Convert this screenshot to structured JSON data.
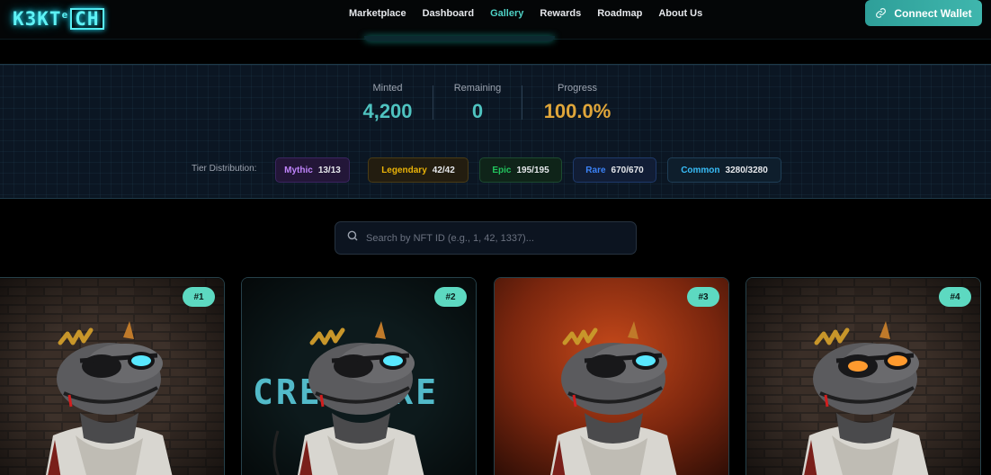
{
  "brand": {
    "logo_text": "K3KT",
    "logo_sup": "e",
    "logo_box": "CH"
  },
  "nav": {
    "items": [
      {
        "label": "Marketplace",
        "active": false
      },
      {
        "label": "Dashboard",
        "active": false
      },
      {
        "label": "Gallery",
        "active": true
      },
      {
        "label": "Rewards",
        "active": false
      },
      {
        "label": "Roadmap",
        "active": false
      },
      {
        "label": "About Us",
        "active": false
      }
    ],
    "connect_label": "Connect Wallet",
    "connect_icon": "link-icon"
  },
  "stats": {
    "minted": {
      "label": "Minted",
      "value": "4,200",
      "color": "#4fc3c0"
    },
    "remaining": {
      "label": "Remaining",
      "value": "0",
      "color": "#4fc3c0"
    },
    "progress": {
      "label": "Progress",
      "value": "100.0%",
      "color": "#e0a63a"
    }
  },
  "tiers": {
    "label": "Tier Distribution:",
    "items": [
      {
        "name": "Mythic",
        "count": "13/13",
        "color": "#c084fc",
        "bg": "#231638",
        "border": "#3b2560"
      },
      {
        "name": "Legendary",
        "count": "42/42",
        "color": "#eab308",
        "bg": "#231d10",
        "border": "#4a3c15"
      },
      {
        "name": "Epic",
        "count": "195/195",
        "color": "#22c55e",
        "bg": "#0f2419",
        "border": "#1c4a30"
      },
      {
        "name": "Rare",
        "count": "670/670",
        "color": "#3b82f6",
        "bg": "#111d35",
        "border": "#1e3a6b"
      },
      {
        "name": "Common",
        "count": "3280/3280",
        "color": "#38bdf8",
        "bg": "#0e1e2c",
        "border": "#1f3e56"
      }
    ]
  },
  "search": {
    "placeholder": "Search by NFT ID (e.g., 1, 42, 1337)...",
    "icon": "search-icon"
  },
  "gallery": {
    "cards": [
      {
        "id": "#1",
        "background": "brick",
        "eye_color": "#59e8ff"
      },
      {
        "id": "#2",
        "background": "cyber-text",
        "eye_color": "#59e8ff",
        "overlay_text": "CREATURE"
      },
      {
        "id": "#3",
        "background": "rust",
        "eye_color": "#59e8ff"
      },
      {
        "id": "#4",
        "background": "brick",
        "eye_color": "#ff9a2e"
      }
    ]
  }
}
